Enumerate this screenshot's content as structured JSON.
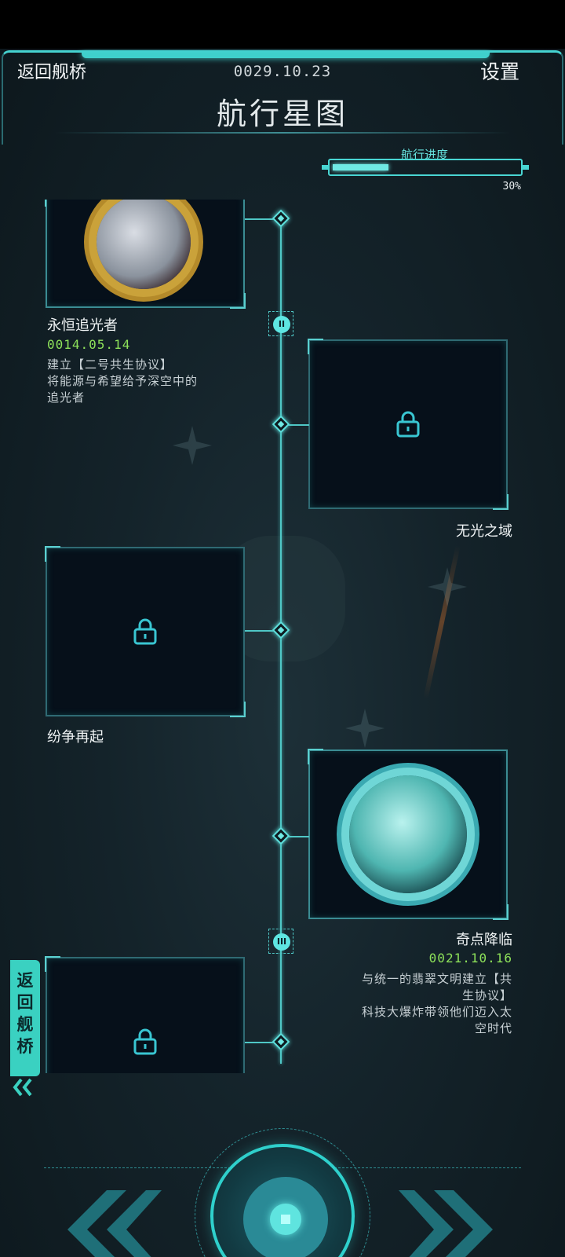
{
  "header": {
    "back_label": "返回舰桥",
    "date": "0029.10.23",
    "settings_label": "设置",
    "title": "航行星图"
  },
  "progress": {
    "label": "航行进度",
    "value_text": "30%",
    "fraction": 0.3
  },
  "chapters": [
    {
      "title": "永恒追光者",
      "date": "0014.05.14",
      "desc_line1": "建立【二号共生协议】",
      "desc_line2": "将能源与希望给予深空中的",
      "desc_line3": "追光者",
      "locked": false,
      "chapter_mark": "II"
    },
    {
      "title": "无光之域",
      "locked": true
    },
    {
      "title": "纷争再起",
      "locked": true
    },
    {
      "title": "奇点降临",
      "date": "0021.10.16",
      "desc_line1": "与统一的翡翠文明建立【共",
      "desc_line2": "生协议】",
      "desc_line3": "科技大爆炸带领他们迈入太",
      "desc_line4": "空时代",
      "locked": false,
      "chapter_mark": "III"
    },
    {
      "title": "",
      "locked": true
    }
  ],
  "side_back": {
    "label_chars": [
      "返",
      "回",
      "舰",
      "桥"
    ]
  },
  "colors": {
    "accent": "#45d3d1",
    "date_green": "#8ee25a",
    "background": "#14232a"
  },
  "icons": {
    "lock": "lock-icon",
    "prev": "double-chevron-left-icon",
    "next": "double-chevron-right-icon"
  }
}
